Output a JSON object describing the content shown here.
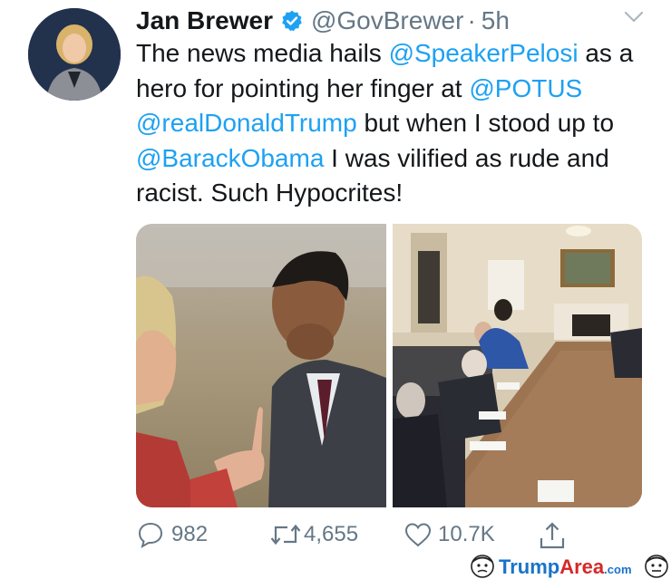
{
  "tweet": {
    "author_name": "Jan Brewer",
    "handle": "@GovBrewer",
    "separator": "·",
    "time": "5h",
    "text_parts": [
      {
        "text": "The news media hails ",
        "mention": false
      },
      {
        "text": "@SpeakerPelosi",
        "mention": true
      },
      {
        "text": " as a hero for pointing her finger at ",
        "mention": false
      },
      {
        "text": "@POTUS",
        "mention": true
      },
      {
        "text": " ",
        "mention": false
      },
      {
        "text": "@realDonaldTrump",
        "mention": true
      },
      {
        "text": " but when I stood up to ",
        "mention": false
      },
      {
        "text": "@BarackObama",
        "mention": true
      },
      {
        "text": " I was vilified as rude and racist. Such Hypocrites!",
        "mention": false
      }
    ]
  },
  "actions": {
    "replies": "982",
    "retweets": "4,655",
    "likes": "10.7K"
  },
  "watermark": {
    "part1": "Trump",
    "part2": "Area",
    "part3": ".com"
  },
  "colors": {
    "mention": "#1da1f2",
    "verified": "#1da1f2",
    "muted": "#657786"
  },
  "icons": [
    "verified-badge-icon",
    "chevron-down-icon",
    "reply-icon",
    "retweet-icon",
    "like-icon",
    "share-icon"
  ]
}
